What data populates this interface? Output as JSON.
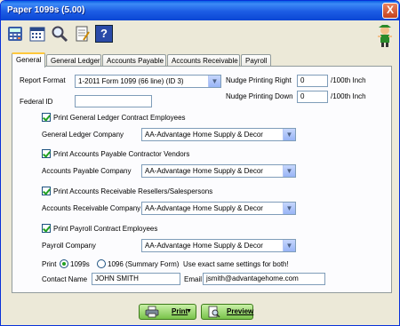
{
  "window": {
    "title": "Paper 1099s (5.00)",
    "close": "X"
  },
  "toolbar": {
    "icons": [
      "calculator-icon",
      "calendar-icon",
      "magnifier-icon",
      "notepad-icon",
      "help-icon"
    ],
    "help_glyph": "?"
  },
  "tabs": [
    "General",
    "General Ledger",
    "Accounts Payable",
    "Accounts Receivable",
    "Payroll"
  ],
  "form": {
    "report_format_label": "Report Format",
    "report_format_value": "1-2011 Form 1099 (66 line) (ID 3)",
    "federal_id_label": "Federal ID",
    "federal_id_value": "",
    "nudge_right_label": "Nudge Printing Right",
    "nudge_right_value": "0",
    "nudge_down_label": "Nudge Printing Down",
    "nudge_down_value": "0",
    "nudge_unit": "/100th Inch",
    "gl_check": "Print General Ledger Contract Employees",
    "gl_company_label": "General Ledger Company",
    "gl_company_value": "AA-Advantage Home Supply & Decor",
    "ap_check": "Print Accounts Payable Contractor Vendors",
    "ap_company_label": "Accounts Payable Company",
    "ap_company_value": "AA-Advantage Home Supply & Decor",
    "ar_check": "Print Accounts Receivable Resellers/Salespersons",
    "ar_company_label": "Accounts Receivable Company",
    "ar_company_value": "AA-Advantage Home Supply & Decor",
    "pr_check": "Print Payroll Contract Employees",
    "pr_company_label": "Payroll Company",
    "pr_company_value": "AA-Advantage Home Supply & Decor",
    "print_label": "Print",
    "radio_1099": "1099s",
    "radio_1096": "1096 (Summary Form)",
    "same_settings_note": "Use exact same settings for both!",
    "contact_label": "Contact Name",
    "contact_value": "JOHN SMITH",
    "email_label": "Email",
    "email_value": "jsmith@advantagehome.com"
  },
  "buttons": {
    "print": "Print",
    "preview": "Preview"
  },
  "colors": {
    "titlebar": "#0a5fe4",
    "accent": "#21a121",
    "tab_highlight": "#ffc83c"
  }
}
